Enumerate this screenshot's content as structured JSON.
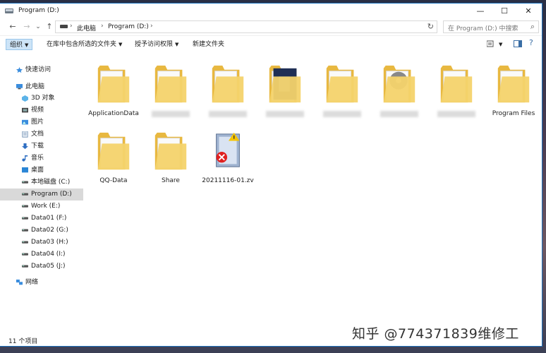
{
  "window": {
    "title": "Program (D:)",
    "accent": "#1e73be",
    "folder_color": "#f4d36b"
  },
  "controls": {
    "minimize": "—",
    "maximize": "☐",
    "close": "✕"
  },
  "nav": {
    "back": "←",
    "forward": "→",
    "recent": "⌄",
    "up": "↑"
  },
  "address": {
    "crumbs": [
      "此电脑",
      "Program (D:)"
    ],
    "sep": "›",
    "refresh": "↻"
  },
  "search": {
    "placeholder": "在 Program (D:) 中搜索",
    "icon": "⌕"
  },
  "toolbar": {
    "organize": "组织",
    "include_library": "在库中包含所选的文件夹",
    "share": "授予访问权限",
    "new_folder": "新建文件夹"
  },
  "sidebar": {
    "items": [
      {
        "label": "快速访问",
        "icon": "star-icon"
      },
      {
        "label": "此电脑",
        "icon": "computer-icon"
      },
      {
        "label": "3D 对象",
        "icon": "cube-icon"
      },
      {
        "label": "视频",
        "icon": "video-icon"
      },
      {
        "label": "图片",
        "icon": "picture-icon"
      },
      {
        "label": "文档",
        "icon": "document-icon"
      },
      {
        "label": "下载",
        "icon": "download-icon"
      },
      {
        "label": "音乐",
        "icon": "music-icon"
      },
      {
        "label": "桌面",
        "icon": "desktop-icon"
      },
      {
        "label": "本地磁盘 (C:)",
        "icon": "drive-icon"
      },
      {
        "label": "Program (D:)",
        "icon": "drive-icon",
        "selected": true
      },
      {
        "label": "Work (E:)",
        "icon": "drive-icon"
      },
      {
        "label": "Data01 (F:)",
        "icon": "drive-icon"
      },
      {
        "label": "Data02 (G:)",
        "icon": "drive-icon"
      },
      {
        "label": "Data03 (H:)",
        "icon": "drive-icon"
      },
      {
        "label": "Data04 (I:)",
        "icon": "drive-icon"
      },
      {
        "label": "Data05 (J:)",
        "icon": "drive-icon"
      },
      {
        "label": "网络",
        "icon": "network-icon"
      }
    ]
  },
  "files": [
    {
      "label": "ApplicationData",
      "type": "folder"
    },
    {
      "label": "",
      "type": "folder",
      "blurred": true
    },
    {
      "label": "",
      "type": "folder",
      "blurred": true
    },
    {
      "label": "",
      "type": "folder-image",
      "blurred": true
    },
    {
      "label": "",
      "type": "folder",
      "blurred": true
    },
    {
      "label": "",
      "type": "folder-disc",
      "blurred": true
    },
    {
      "label": "",
      "type": "folder",
      "blurred": true
    },
    {
      "label": "Program Files",
      "type": "folder"
    },
    {
      "label": "QQ-Data",
      "type": "folder"
    },
    {
      "label": "Share",
      "type": "folder"
    },
    {
      "label": "20211116-01.zv",
      "type": "file-error"
    }
  ],
  "status": {
    "count": "11 个项目"
  },
  "watermark": "知乎 @774371839维修工"
}
